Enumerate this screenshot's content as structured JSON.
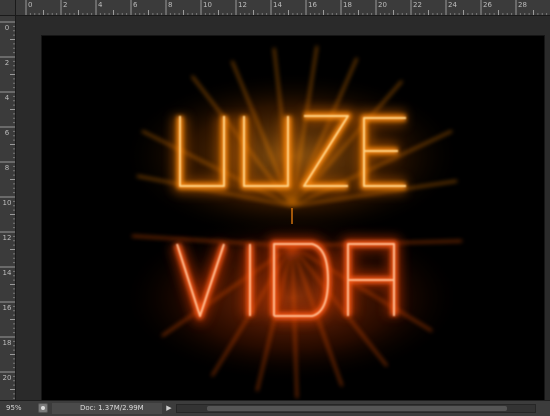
{
  "ruler": {
    "horizontal_labels": [
      "0",
      "2",
      "4",
      "6",
      "8",
      "10",
      "12",
      "14",
      "16",
      "18",
      "20",
      "22",
      "24",
      "26",
      "28"
    ],
    "vertical_labels": [
      "0",
      "2",
      "4",
      "6",
      "8",
      "10",
      "12",
      "14",
      "16",
      "18",
      "20"
    ]
  },
  "canvas": {
    "background": "#000000",
    "glow_colors": [
      "#ff8a00",
      "#ff5a10",
      "#ffd27a"
    ]
  },
  "status": {
    "zoom": "95%",
    "doc_info": "Doc: 1.37M/2.99M",
    "arrow_icon": "triangle-right-icon"
  }
}
